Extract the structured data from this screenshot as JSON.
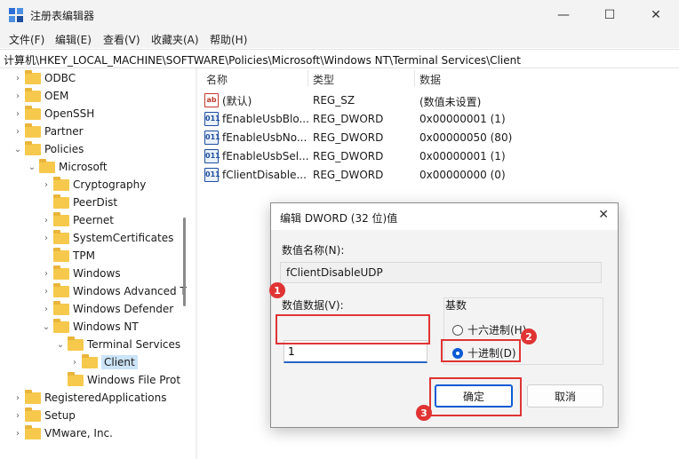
{
  "window": {
    "title": "注册表编辑器"
  },
  "menu": [
    "文件(F)",
    "编辑(E)",
    "查看(V)",
    "收藏夹(A)",
    "帮助(H)"
  ],
  "address": "计算机\\HKEY_LOCAL_MACHINE\\SOFTWARE\\Policies\\Microsoft\\Windows NT\\Terminal Services\\Client",
  "tree": [
    {
      "label": "ODBC"
    },
    {
      "label": "OEM"
    },
    {
      "label": "OpenSSH"
    },
    {
      "label": "Partner"
    },
    {
      "label": "Policies"
    },
    {
      "label": "Microsoft"
    },
    {
      "label": "Cryptography"
    },
    {
      "label": "PeerDist"
    },
    {
      "label": "Peernet"
    },
    {
      "label": "SystemCertificates"
    },
    {
      "label": "TPM"
    },
    {
      "label": "Windows"
    },
    {
      "label": "Windows Advanced T"
    },
    {
      "label": "Windows Defender"
    },
    {
      "label": "Windows NT"
    },
    {
      "label": "Terminal Services"
    },
    {
      "label": "Client"
    },
    {
      "label": "Windows File Prot"
    },
    {
      "label": "RegisteredApplications"
    },
    {
      "label": "Setup"
    },
    {
      "label": "VMware, Inc."
    }
  ],
  "list": {
    "headers": [
      "名称",
      "类型",
      "数据"
    ],
    "rows": [
      {
        "icon": "ab",
        "name": "(默认)",
        "type": "REG_SZ",
        "data": "(数值未设置)"
      },
      {
        "icon": "011",
        "name": "fEnableUsbBlo...",
        "type": "REG_DWORD",
        "data": "0x00000001 (1)"
      },
      {
        "icon": "011",
        "name": "fEnableUsbNo...",
        "type": "REG_DWORD",
        "data": "0x00000050 (80)"
      },
      {
        "icon": "011",
        "name": "fEnableUsbSel...",
        "type": "REG_DWORD",
        "data": "0x00000001 (1)"
      },
      {
        "icon": "011",
        "name": "fClientDisable...",
        "type": "REG_DWORD",
        "data": "0x00000000 (0)"
      }
    ]
  },
  "dialog": {
    "title": "编辑 DWORD (32 位)值",
    "name_label": "数值名称(N):",
    "name_value": "fClientDisableUDP",
    "data_label": "数值数据(V):",
    "data_value": "1",
    "base_label": "基数",
    "radio_hex": "十六进制(H)",
    "radio_dec": "十进制(D)",
    "ok": "确定",
    "cancel": "取消"
  },
  "badges": [
    "1",
    "2",
    "3"
  ]
}
